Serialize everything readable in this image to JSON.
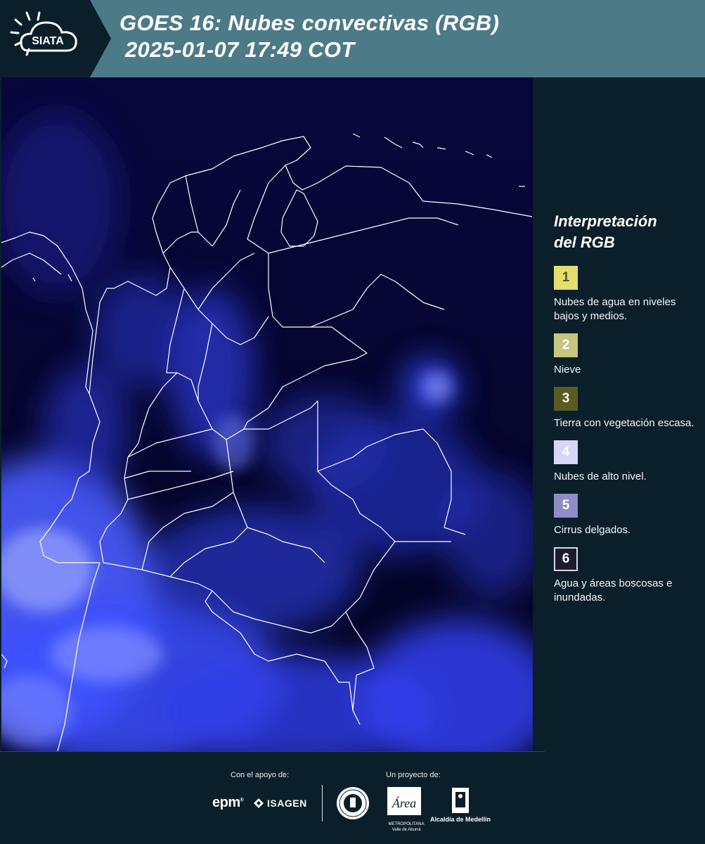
{
  "header": {
    "logo_text": "SIATA",
    "title_line1": "GOES 16: Nubes convectivas (RGB)",
    "title_line2": "2025-01-07 17:49 COT",
    "background_color": "#4d7a87"
  },
  "map": {
    "background_color": "#050433",
    "cloud_color": "#3a4cff",
    "boundary_color": "#ffffff"
  },
  "legend": {
    "title_line1": "Interpretación",
    "title_line2": "del RGB",
    "items": [
      {
        "number": "1",
        "label": "Nubes de agua en niveles bajos y medios.",
        "color": "#e3df6a",
        "text_color": "#555530"
      },
      {
        "number": "2",
        "label": "Nieve",
        "color": "#c8c580",
        "text_color": "#ffffff"
      },
      {
        "number": "3",
        "label": "Tierra con vegetación escasa.",
        "color": "#5b5a22",
        "text_color": "#ffffff"
      },
      {
        "number": "4",
        "label": "Nubes de alto nivel.",
        "color": "#d6d6f5",
        "text_color": "#ffffff"
      },
      {
        "number": "5",
        "label": "Cirrus delgados.",
        "color": "#8e8dc8",
        "text_color": "#ffffff"
      },
      {
        "number": "6",
        "label": "Agua y áreas boscosas e inundadas.",
        "color": "#1c1c2e",
        "text_color": "#ffffff"
      }
    ]
  },
  "footer": {
    "support_label": "Con el apoyo de:",
    "project_label": "Un proyecto de:",
    "sponsor1": "epm",
    "sponsor2": "ISAGEN",
    "metro_text": "METROPOLITANA Valle de Aburrá",
    "metro_script": "Área",
    "alcaldia_text": "Alcaldía de Medellín"
  }
}
